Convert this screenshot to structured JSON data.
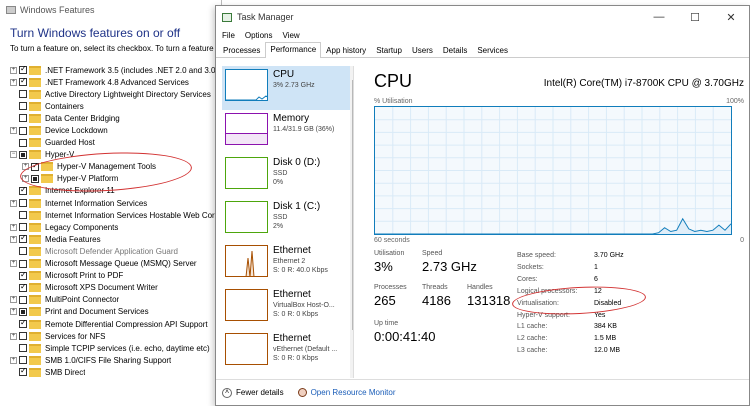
{
  "windows_features": {
    "title": "Windows Features",
    "heading": "Turn Windows features on or off",
    "description": "To turn a feature on, select its checkbox. To turn a feature",
    "features": [
      {
        "label": ".NET Framework 3.5 (includes .NET 2.0 and 3.0)",
        "state": "checked",
        "expand": "+",
        "level": 0
      },
      {
        "label": ".NET Framework 4.8 Advanced Services",
        "state": "checked",
        "expand": "+",
        "level": 0
      },
      {
        "label": "Active Directory Lightweight Directory Services",
        "state": "unchecked",
        "expand": "",
        "level": 0
      },
      {
        "label": "Containers",
        "state": "unchecked",
        "expand": "",
        "level": 0
      },
      {
        "label": "Data Center Bridging",
        "state": "unchecked",
        "expand": "",
        "level": 0
      },
      {
        "label": "Device Lockdown",
        "state": "unchecked",
        "expand": "+",
        "level": 0
      },
      {
        "label": "Guarded Host",
        "state": "unchecked",
        "expand": "",
        "level": 0
      },
      {
        "label": "Hyper-V",
        "state": "partial",
        "expand": "−",
        "level": 0
      },
      {
        "label": "Hyper-V Management Tools",
        "state": "checked",
        "expand": "+",
        "level": 1
      },
      {
        "label": "Hyper-V Platform",
        "state": "partial",
        "expand": "+",
        "level": 1
      },
      {
        "label": "Internet Explorer 11",
        "state": "checked",
        "expand": "",
        "level": 0
      },
      {
        "label": "Internet Information Services",
        "state": "unchecked",
        "expand": "+",
        "level": 0
      },
      {
        "label": "Internet Information Services Hostable Web Core",
        "state": "unchecked",
        "expand": "",
        "level": 0
      },
      {
        "label": "Legacy Components",
        "state": "unchecked",
        "expand": "+",
        "level": 0
      },
      {
        "label": "Media Features",
        "state": "checked",
        "expand": "+",
        "level": 0
      },
      {
        "label": "Microsoft Defender Application Guard",
        "state": "unchecked",
        "expand": "",
        "level": 0,
        "disabled": true
      },
      {
        "label": "Microsoft Message Queue (MSMQ) Server",
        "state": "unchecked",
        "expand": "+",
        "level": 0
      },
      {
        "label": "Microsoft Print to PDF",
        "state": "checked",
        "expand": "",
        "level": 0
      },
      {
        "label": "Microsoft XPS Document Writer",
        "state": "checked",
        "expand": "",
        "level": 0
      },
      {
        "label": "MultiPoint Connector",
        "state": "unchecked",
        "expand": "+",
        "level": 0
      },
      {
        "label": "Print and Document Services",
        "state": "partial",
        "expand": "+",
        "level": 0
      },
      {
        "label": "Remote Differential Compression API Support",
        "state": "checked",
        "expand": "",
        "level": 0
      },
      {
        "label": "Services for NFS",
        "state": "unchecked",
        "expand": "+",
        "level": 0
      },
      {
        "label": "Simple TCPIP services (i.e. echo, daytime etc)",
        "state": "unchecked",
        "expand": "",
        "level": 0
      },
      {
        "label": "SMB 1.0/CIFS File Sharing Support",
        "state": "unchecked",
        "expand": "+",
        "level": 0
      },
      {
        "label": "SMB Direct",
        "state": "checked",
        "expand": "",
        "level": 0
      }
    ]
  },
  "task_manager": {
    "title": "Task Manager",
    "menu": [
      "File",
      "Options",
      "View"
    ],
    "tabs": [
      "Processes",
      "Performance",
      "App history",
      "Startup",
      "Users",
      "Details",
      "Services"
    ],
    "active_tab": "Performance",
    "tiles": [
      {
        "name": "CPU",
        "line1": "3% 2.73 GHz",
        "line2": "",
        "kind": "cpu"
      },
      {
        "name": "Memory",
        "line1": "11.4/31.9 GB (36%)",
        "line2": "",
        "kind": "mem"
      },
      {
        "name": "Disk 0 (D:)",
        "line1": "SSD",
        "line2": "0%",
        "kind": "disk"
      },
      {
        "name": "Disk 1 (C:)",
        "line1": "SSD",
        "line2": "2%",
        "kind": "disk"
      },
      {
        "name": "Ethernet",
        "line1": "Ethernet 2",
        "line2": "S: 0 R: 40.0 Kbps",
        "kind": "eth"
      },
      {
        "name": "Ethernet",
        "line1": "VirtualBox Host-O...",
        "line2": "S: 0 R: 0 Kbps",
        "kind": "eth"
      },
      {
        "name": "Ethernet",
        "line1": "vEthernet (Default ...",
        "line2": "S: 0 R: 0 Kbps",
        "kind": "eth"
      }
    ],
    "detail": {
      "title": "CPU",
      "model": "Intel(R) Core(TM) i7-8700K CPU @ 3.70GHz",
      "graph_label": "% Utilisation",
      "graph_max": "100%",
      "graph_time": "60 seconds",
      "graph_min": "0",
      "utilisation_label": "Utilisation",
      "utilisation": "3%",
      "speed_label": "Speed",
      "speed": "2.73 GHz",
      "processes_label": "Processes",
      "processes": "265",
      "threads_label": "Threads",
      "threads": "4186",
      "handles_label": "Handles",
      "handles": "131318",
      "uptime_label": "Up time",
      "uptime": "0:00:41:40",
      "specs": [
        {
          "k": "Base speed:",
          "v": "3.70 GHz"
        },
        {
          "k": "Sockets:",
          "v": "1"
        },
        {
          "k": "Cores:",
          "v": "6"
        },
        {
          "k": "Logical processors:",
          "v": "12"
        },
        {
          "k": "Virtualisation:",
          "v": "Disabled"
        },
        {
          "k": "Hyper-V support:",
          "v": "Yes"
        },
        {
          "k": "L1 cache:",
          "v": "384 KB"
        },
        {
          "k": "L2 cache:",
          "v": "1.5 MB"
        },
        {
          "k": "L3 cache:",
          "v": "12.0 MB"
        }
      ],
      "cpu_history": [
        0,
        0,
        0,
        0,
        0,
        0,
        0,
        0,
        0,
        0,
        0,
        0,
        0,
        0,
        0,
        0,
        0,
        0,
        0,
        0,
        0,
        0,
        0,
        0,
        0,
        0,
        0,
        0,
        0,
        0,
        0,
        0,
        0,
        0,
        0,
        0,
        0,
        0,
        0,
        0,
        0,
        0,
        0,
        0,
        0,
        0,
        0,
        1,
        5,
        2,
        3,
        12,
        4,
        2,
        3,
        2,
        3,
        7,
        3,
        8
      ]
    },
    "footer": {
      "fewer": "Fewer details",
      "monitor": "Open Resource Monitor"
    }
  },
  "colors": {
    "cpu": "#117dbb",
    "memory": "#8b12ae",
    "disk": "#4da60c",
    "ethernet": "#a74f01",
    "annotation": "#d23232"
  }
}
